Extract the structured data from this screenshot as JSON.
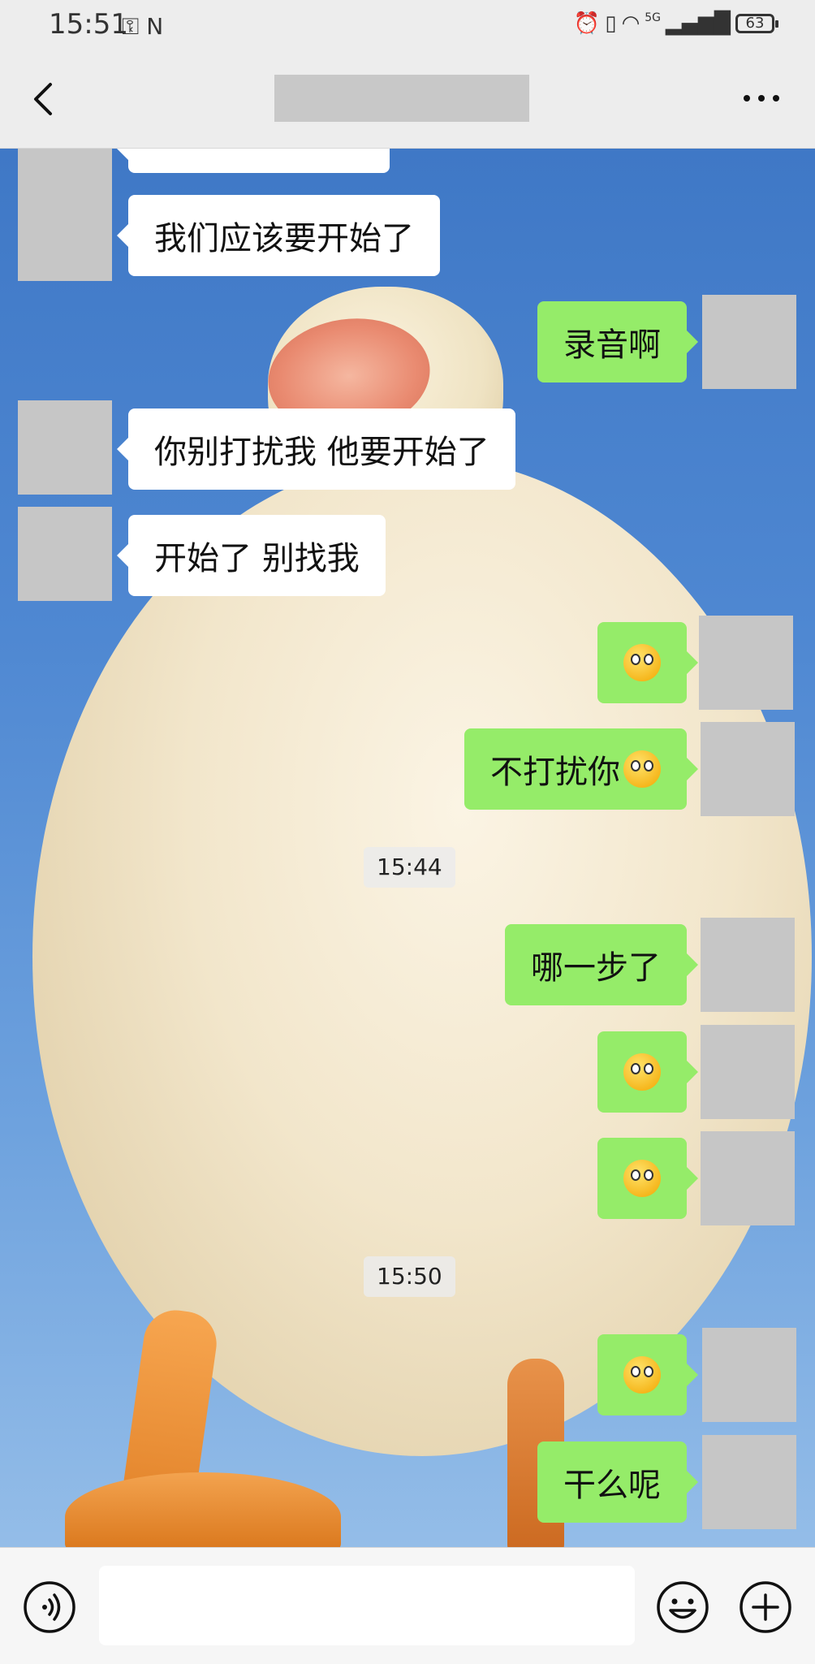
{
  "status_bar": {
    "time": "15:51",
    "left_icons": "⚿ N",
    "network": "5G",
    "battery": "63"
  },
  "nav": {
    "back_icon": "chevron-left-icon",
    "more_icon": "ellipsis-icon"
  },
  "messages": [
    {
      "side": "left",
      "text": "我们应该要开始了"
    },
    {
      "side": "right",
      "text": "录音啊"
    },
    {
      "side": "left",
      "text": "你别打扰我 他要开始了"
    },
    {
      "side": "left",
      "text": "开始了 别找我"
    },
    {
      "side": "right",
      "emoji": "pleading-face"
    },
    {
      "side": "right",
      "text": "不打扰你",
      "emoji": "flushed-face"
    },
    {
      "side": "system",
      "text": "15:44"
    },
    {
      "side": "right",
      "text": "哪一步了"
    },
    {
      "side": "right",
      "emoji": "flushed-face"
    },
    {
      "side": "right",
      "emoji": "flushed-face"
    },
    {
      "side": "system",
      "text": "15:50"
    },
    {
      "side": "right",
      "emoji": "pleading-face"
    },
    {
      "side": "right",
      "text": "干么呢"
    }
  ],
  "input_bar": {
    "voice_icon": "voice-icon",
    "input_value": "",
    "emoji_icon": "smiley-icon",
    "plus_icon": "plus-circle-icon"
  },
  "colors": {
    "my_bubble": "#95ec69",
    "their_bubble": "#ffffff",
    "bar_background": "#ededed"
  }
}
